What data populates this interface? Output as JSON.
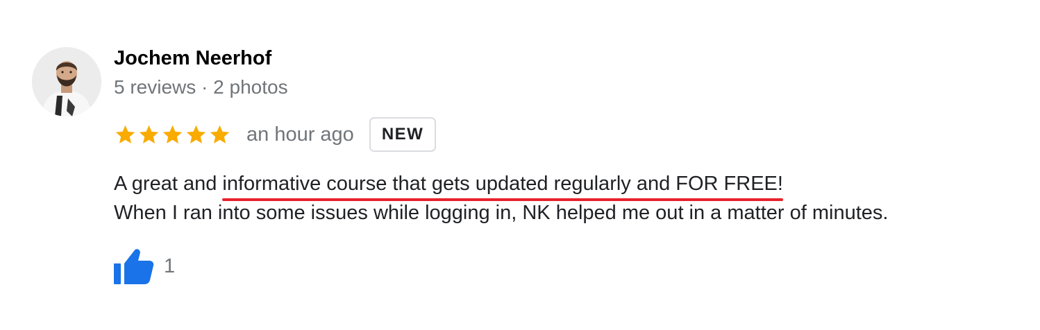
{
  "review": {
    "reviewer_name": "Jochem Neerhof",
    "reviewer_meta": "5 reviews · 2 photos",
    "rating": 5,
    "rating_max": 5,
    "time": "an hour ago",
    "badge": "NEW",
    "text": {
      "line1_before": "A great and ",
      "line1_highlight": "informative course that gets updated regularly and FOR FREE!",
      "line2": "When I ran into some issues while logging in, NK helped me out in a matter of minutes."
    },
    "likes": "1"
  },
  "icons": {
    "star": "star-icon",
    "like": "thumbs-up-icon"
  },
  "colors": {
    "star": "#f9ab00",
    "like": "#1a73e8",
    "underline": "#e8232c",
    "meta_text": "#70757a"
  }
}
